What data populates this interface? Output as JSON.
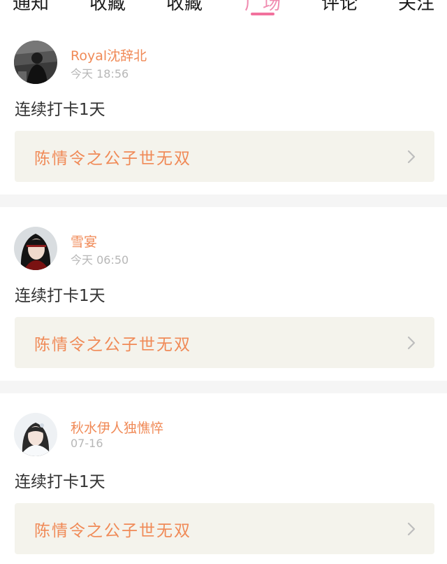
{
  "tabs": [
    {
      "label": "通知"
    },
    {
      "label": "收藏"
    },
    {
      "label": "收藏"
    },
    {
      "label": "广场"
    },
    {
      "label": "评论"
    },
    {
      "label": "关注"
    }
  ],
  "active_tab_index": 3,
  "colors": {
    "accent_pink": "#f2719d",
    "username_orange": "#f08a57",
    "card_bg": "#f4f3ec",
    "separator_gray": "#f5f5f5"
  },
  "posts": [
    {
      "username": "Royal沈辞北",
      "time": "今天 18:56",
      "content": "连续打卡1天",
      "card_title": "陈情令之公子世无双"
    },
    {
      "username": "雪宴",
      "time": "今天 06:50",
      "content": "连续打卡1天",
      "card_title": "陈情令之公子世无双"
    },
    {
      "username": "秋水伊人独憔悴",
      "time": "07-16",
      "content": "连续打卡1天",
      "card_title": "陈情令之公子世无双"
    }
  ]
}
